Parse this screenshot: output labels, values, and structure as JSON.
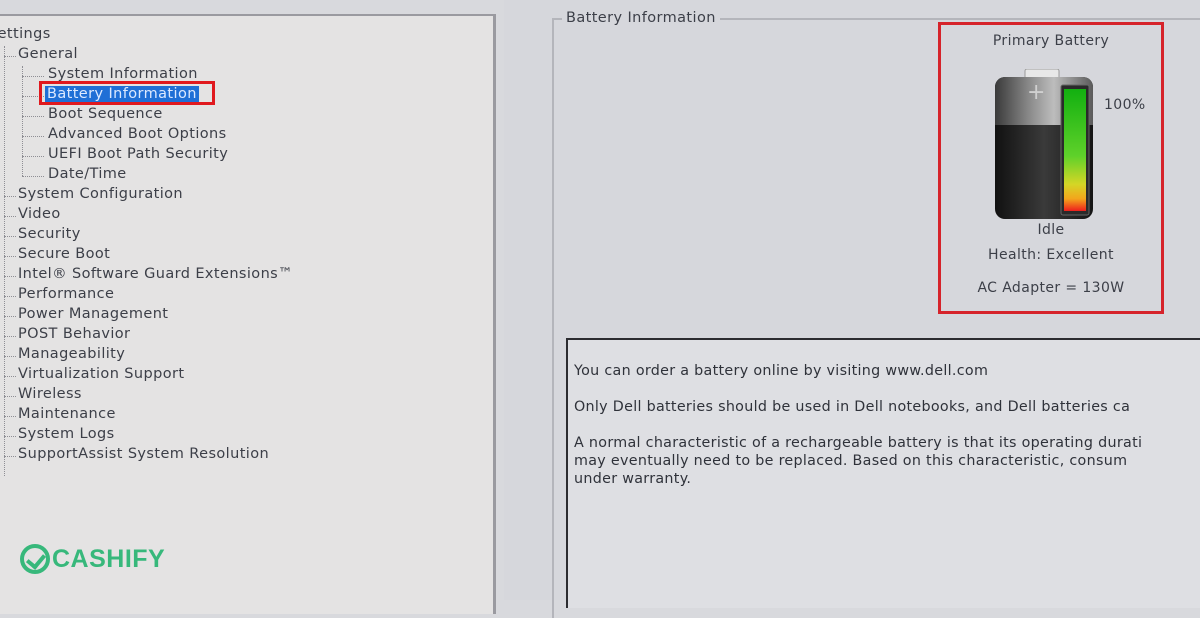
{
  "tree": {
    "root": "Settings",
    "groups": [
      {
        "label": "General",
        "children": [
          "System Information",
          "Battery Information",
          "Boot Sequence",
          "Advanced Boot Options",
          "UEFI Boot Path Security",
          "Date/Time"
        ],
        "selected_index": 1
      },
      {
        "label": "System Configuration"
      },
      {
        "label": "Video"
      },
      {
        "label": "Security"
      },
      {
        "label": "Secure Boot"
      },
      {
        "label": "Intel® Software Guard Extensions™"
      },
      {
        "label": "Performance"
      },
      {
        "label": "Power Management"
      },
      {
        "label": "POST Behavior"
      },
      {
        "label": "Manageability"
      },
      {
        "label": "Virtualization Support"
      },
      {
        "label": "Wireless"
      },
      {
        "label": "Maintenance"
      },
      {
        "label": "System Logs"
      },
      {
        "label": "SupportAssist System Resolution"
      }
    ]
  },
  "panel": {
    "title": "Battery Information",
    "battery": {
      "heading": "Primary Battery",
      "percent_label": "100%",
      "charge_fraction": 1.0,
      "state": "Idle",
      "health": "Health: Excellent",
      "adapter": "AC Adapter = 130W"
    },
    "info": {
      "line1": "You can order a battery online by visiting www.dell.com",
      "line2": "Only Dell batteries should be used in Dell notebooks, and Dell batteries ca",
      "line3": "A normal characteristic of a rechargeable battery is that its operating durati",
      "line4": "may eventually need to be replaced.  Based on this characteristic, consum",
      "line5": "under warranty."
    }
  },
  "logo": {
    "text": "CASHIFY",
    "icon": "cashify-check-icon",
    "color": "#37b87b"
  },
  "colors": {
    "highlight": "#e0191e",
    "selection": "#1f6fd6"
  }
}
